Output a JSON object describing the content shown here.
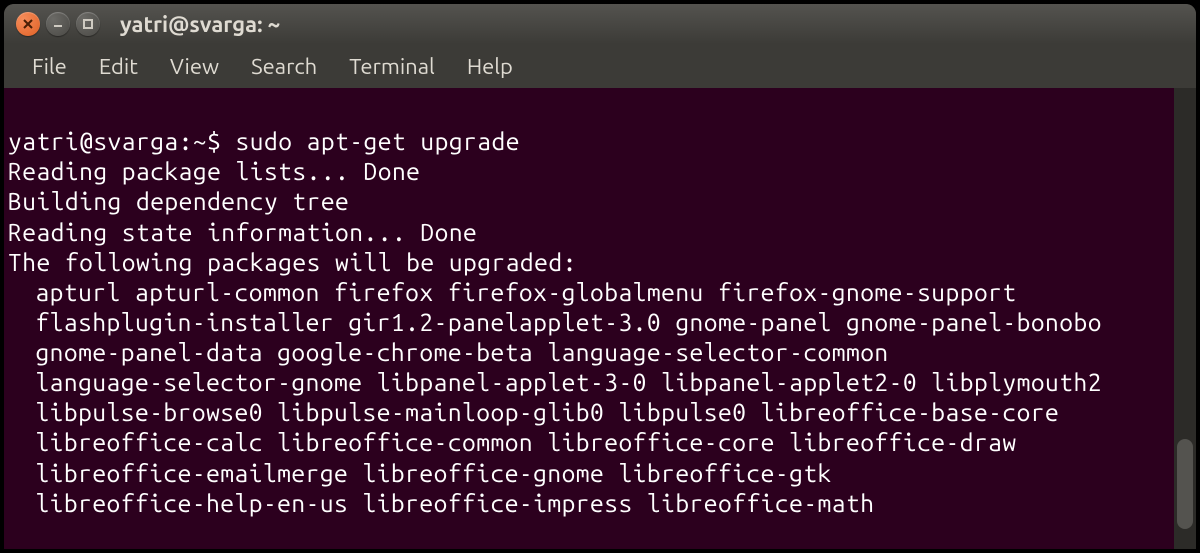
{
  "window": {
    "title": "yatri@svarga: ~"
  },
  "menubar": {
    "items": [
      "File",
      "Edit",
      "View",
      "Search",
      "Terminal",
      "Help"
    ]
  },
  "terminal": {
    "prompt": "yatri@svarga:~$",
    "command": "sudo apt-get upgrade",
    "output_lines": [
      "Reading package lists... Done",
      "Building dependency tree",
      "Reading state information... Done",
      "The following packages will be upgraded:"
    ],
    "package_lines": [
      "apturl apturl-common firefox firefox-globalmenu firefox-gnome-support",
      "flashplugin-installer gir1.2-panelapplet-3.0 gnome-panel gnome-panel-bonobo",
      "gnome-panel-data google-chrome-beta language-selector-common",
      "language-selector-gnome libpanel-applet-3-0 libpanel-applet2-0 libplymouth2",
      "libpulse-browse0 libpulse-mainloop-glib0 libpulse0 libreoffice-base-core",
      "libreoffice-calc libreoffice-common libreoffice-core libreoffice-draw",
      "libreoffice-emailmerge libreoffice-gnome libreoffice-gtk",
      "libreoffice-help-en-us libreoffice-impress libreoffice-math"
    ]
  }
}
